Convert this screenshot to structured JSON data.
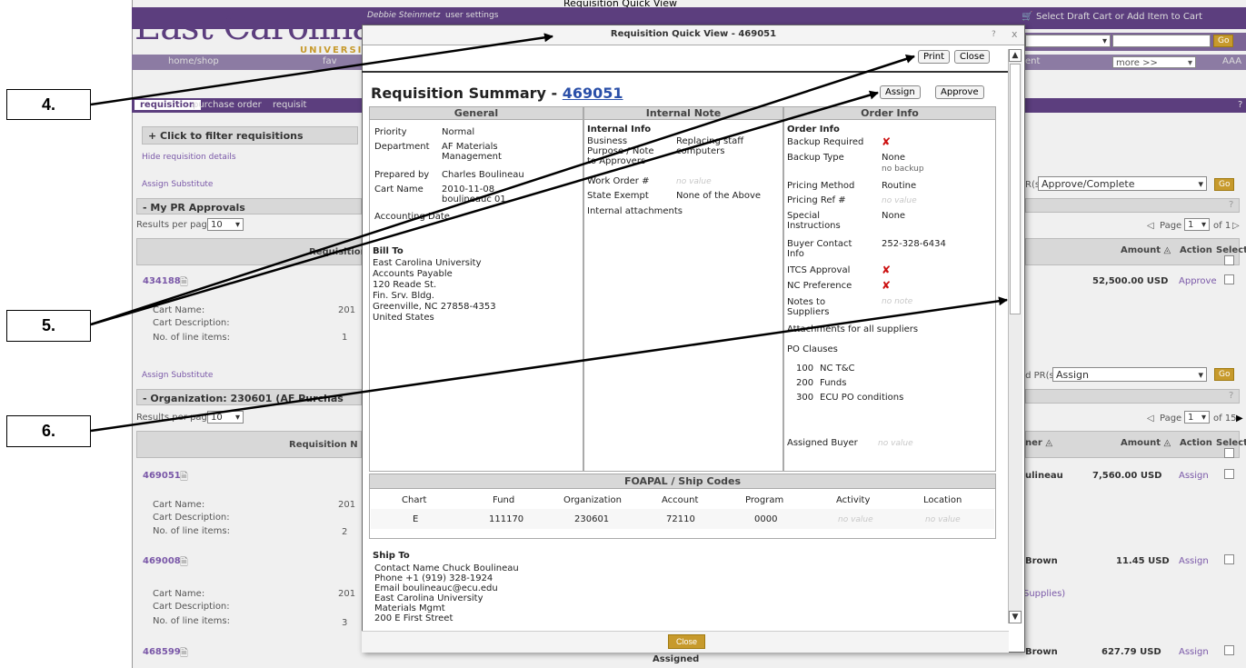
{
  "app": {
    "top_center": "Requisition Quick View",
    "user": "Debbie Steinmetz",
    "user_settings": "user settings",
    "cart_link": "Select Draft Cart or Add Item to Cart",
    "logo_main": "East Carolina",
    "logo_sub": "UNIVERSITY",
    "nav_home": "home/shop",
    "nav_fav": "fav",
    "nav_ent": "ent",
    "nav_more": "more >>",
    "font_a": "AAA",
    "go": "Go",
    "help": "?"
  },
  "subnav": {
    "requisition": "requisition",
    "purchase_order": "purchase order",
    "requisit": "requisit"
  },
  "left": {
    "filter": "+ Click to filter requisitions",
    "hide_details": "Hide requisition details",
    "assign_sub1": "Assign Substitute",
    "pr_approvals": "- My PR Approvals",
    "results_per_page": "Results per page",
    "rpp_value": "10",
    "requisition_col": "Requisition",
    "r1_id": "434188",
    "cart_name": "Cart Name:",
    "cart_desc": "Cart Description:",
    "line_items": "No. of line items:",
    "r1_cartname": "201",
    "r1_lines": "1",
    "assign_sub2": "Assign Substitute",
    "org": "- Organization: 230601 (AF Purchas",
    "rpp2_value": "10",
    "requisition_n": "Requisition N",
    "r2_id": "469051",
    "r2_cartname": "201",
    "r2_lines": "2",
    "r3_id": "469008",
    "r3_cartname": "201",
    "r3_lines": "3",
    "r4_id": "468599"
  },
  "right": {
    "prs": "PR(s)",
    "approve_complete": "Approve/Complete",
    "page": "Page",
    "page1": "1",
    "of1": "of 1",
    "amount": "Amount",
    "action": "Action",
    "select": "Select",
    "r1_amount": "52,500.00 USD",
    "r1_action": "Approve",
    "ted_prs": "ted PR(s)",
    "assign_sel": "Assign",
    "page2": "1",
    "of15": "of 15",
    "owner": "ner",
    "r2_owner": "ulineau",
    "r2_amount": "7,560.00 USD",
    "r2_action": "Assign",
    "r3_owner": "Brown",
    "r3_amount": "11.45 USD",
    "r3_action": "Assign",
    "supplies": "Supplies)",
    "r4_owner": "Brown",
    "r4_amount": "627.79 USD",
    "r4_action": "Assign",
    "assigned": "Assigned"
  },
  "callouts": [
    "4.",
    "5.",
    "6."
  ],
  "modal": {
    "title": "Requisition Quick View - 469051",
    "help": "?",
    "close_x": "x",
    "print": "Print",
    "close": "Close",
    "summary_title": "Requisition Summary - ",
    "req_no": "469051",
    "assign": "Assign",
    "approve": "Approve",
    "general": {
      "header": "General",
      "priority_l": "Priority",
      "priority_v": "Normal",
      "dept_l": "Department",
      "dept_v": "AF Materials\nManagement",
      "prep_l": "Prepared by",
      "prep_v": "Charles Boulineau",
      "cart_l": "Cart Name",
      "cart_v": "2010-11-08\nboulineauc 01",
      "acct_l": "Accounting Date",
      "bill_to": "Bill To",
      "bill_addr": "East Carolina University\nAccounts Payable\n120 Reade St.\nFin. Srv. Bldg.\nGreenville, NC 27858-4353\nUnited States"
    },
    "internal": {
      "header": "Internal Note",
      "info": "Internal Info",
      "purpose_l": "Business\nPurpose / Note\nto Approvers",
      "purpose_v": "Replacing staff\ncomputers",
      "wo_l": "Work Order #",
      "wo_v": "no value",
      "state_l": "State Exempt",
      "state_v": "None of the Above",
      "attach": "Internal attachments"
    },
    "order": {
      "header": "Order Info",
      "info": "Order Info",
      "backup_req": "Backup Required",
      "backup_type": "Backup Type",
      "backup_type_v": "None",
      "backup_type_v2": "no backup",
      "pricing_method": "Pricing Method",
      "pricing_method_v": "Routine",
      "pricing_ref": "Pricing Ref #",
      "pricing_ref_v": "no value",
      "special": "Special\nInstructions",
      "special_v": "None",
      "buyer_contact": "Buyer Contact\nInfo",
      "buyer_contact_v": "252-328-6434",
      "itcs": "ITCS Approval",
      "nc_pref": "NC Preference",
      "notes": "Notes to\nSuppliers",
      "notes_v": "no note",
      "attach_all": "Attachments for all suppliers",
      "po_clauses": "PO Clauses",
      "clauses": [
        {
          "code": "100",
          "text": "NC T&C"
        },
        {
          "code": "200",
          "text": "Funds"
        },
        {
          "code": "300",
          "text": "ECU PO conditions"
        }
      ],
      "assigned_buyer": "Assigned Buyer",
      "assigned_buyer_v": "no value"
    },
    "foapal": {
      "header": "FOAPAL / Ship Codes",
      "cols": [
        "Chart",
        "Fund",
        "Organization",
        "Account",
        "Program",
        "Activity",
        "Location"
      ],
      "row": [
        "E",
        "111170",
        "230601",
        "72110",
        "0000",
        "no value",
        "no value"
      ]
    },
    "ship_to": {
      "header": "Ship To",
      "lines": "Contact Name Chuck Boulineau\nPhone +1 (919) 328-1924\nEmail boulineauc@ecu.edu\nEast Carolina University\nMaterials Mgmt\n200 E First Street"
    },
    "bottom_close": "Close"
  },
  "colors": {
    "purple": "#5c3e7e",
    "gold": "#c79a2c",
    "link": "#7a58a8",
    "redx": "#cc1111"
  }
}
